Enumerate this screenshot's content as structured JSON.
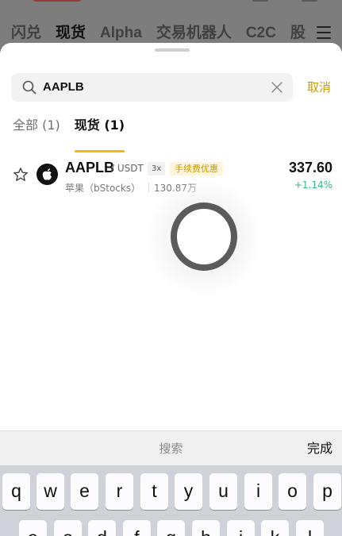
{
  "background": {
    "tabs": [
      "闪兑",
      "现货",
      "Alpha",
      "交易机器人",
      "C2C",
      "股"
    ],
    "active_tab": "现货"
  },
  "search": {
    "value": "AAPLB",
    "cancel_label": "取消"
  },
  "filter_tabs": [
    {
      "label": "全部 (1)",
      "active": false
    },
    {
      "label": "现货 (1)",
      "active": true
    }
  ],
  "result": {
    "symbol": "AAPLB",
    "quote": "/ USDT",
    "leverage": "3x",
    "fee_badge": "手续费优惠",
    "name": "苹果（bStocks）",
    "volume": "130.87万",
    "price": "337.60",
    "change": "+1.14%",
    "logo_icon": "apple-icon"
  },
  "keyboard": {
    "search_label": "搜索",
    "done_label": "完成",
    "row1": [
      "q",
      "w",
      "e",
      "r",
      "t",
      "y",
      "u",
      "i",
      "o",
      "p"
    ],
    "row2": [
      "a",
      "s",
      "d",
      "f",
      "g",
      "h",
      "j",
      "k",
      "l"
    ]
  },
  "colors": {
    "accent": "#f0b90b",
    "up": "#2ebd85",
    "cancel": "#c99a00"
  }
}
